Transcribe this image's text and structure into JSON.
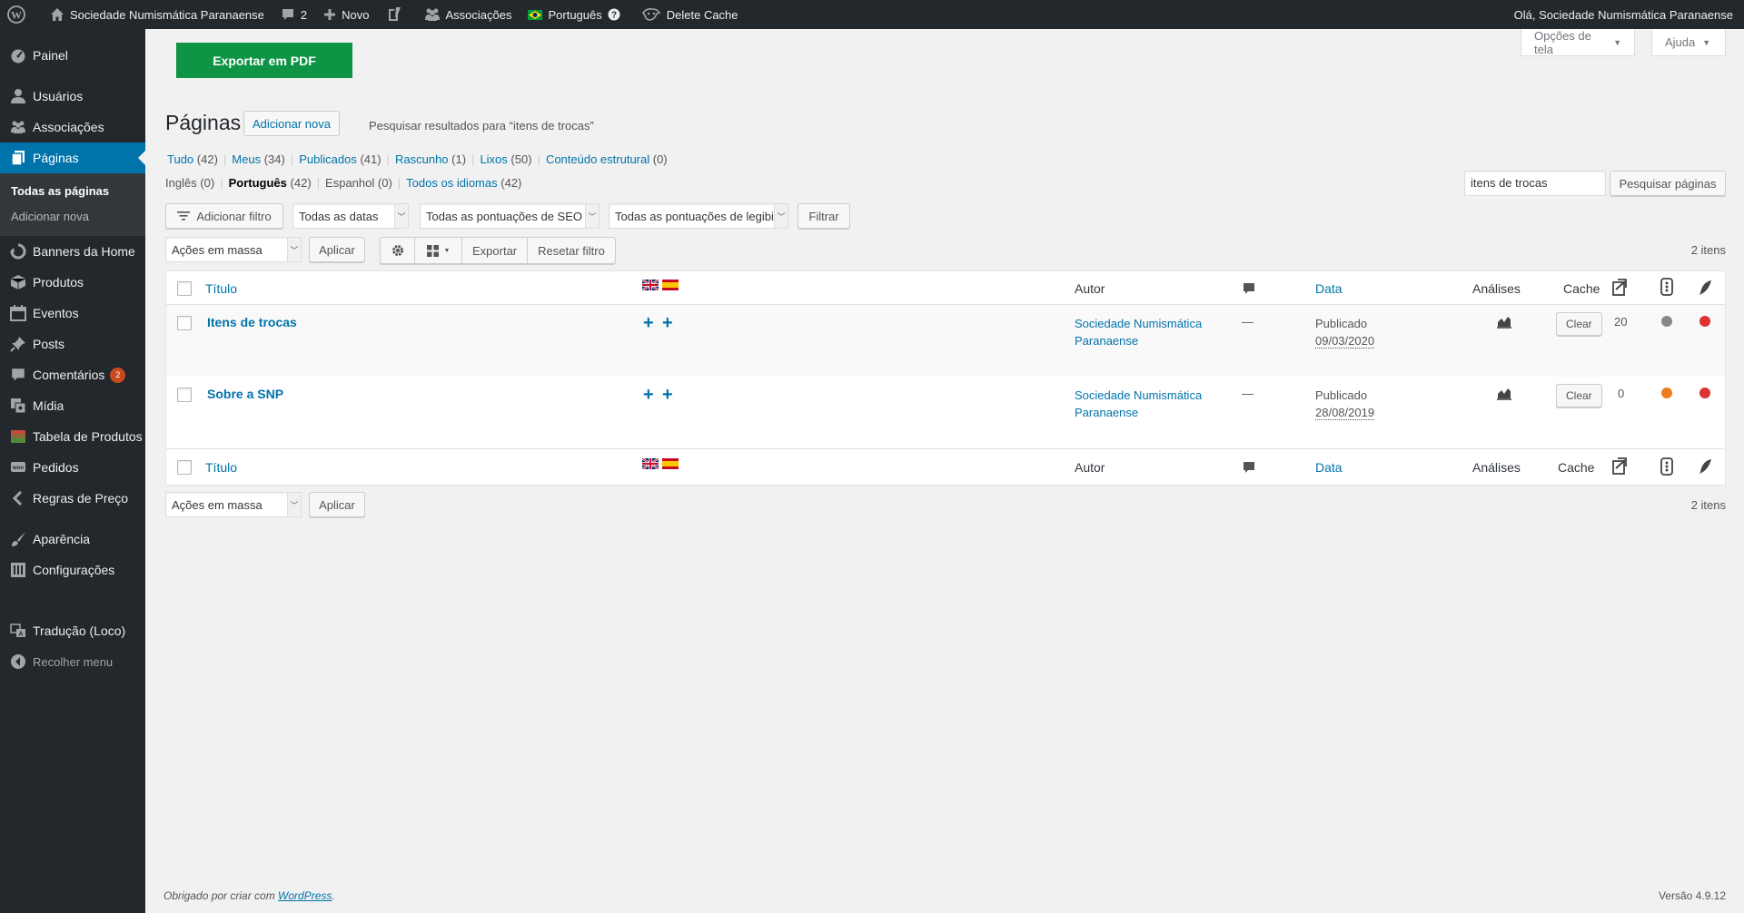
{
  "adminbar": {
    "site_name": "Sociedade Numismática Paranaense",
    "comments_count": "2",
    "new_label": "Novo",
    "associations_label": "Associações",
    "language_label": "Português",
    "delete_cache_label": "Delete Cache",
    "greeting": "Olá, Sociedade Numismática Paranaense"
  },
  "sidebar": {
    "items": [
      {
        "label": "Painel"
      },
      {
        "label": "Usuários"
      },
      {
        "label": "Associações"
      },
      {
        "label": "Páginas"
      },
      {
        "label": "Banners da Home"
      },
      {
        "label": "Produtos"
      },
      {
        "label": "Eventos"
      },
      {
        "label": "Posts"
      },
      {
        "label": "Comentários",
        "badge": "2"
      },
      {
        "label": "Mídia"
      },
      {
        "label": "Tabela de Produtos"
      },
      {
        "label": "Pedidos"
      },
      {
        "label": "Regras de Preço"
      },
      {
        "label": "Aparência"
      },
      {
        "label": "Configurações"
      },
      {
        "label": "Tradução (Loco)"
      },
      {
        "label": "Recolher menu"
      }
    ],
    "submenu": [
      "Todas as páginas",
      "Adicionar nova"
    ]
  },
  "screen_options": {
    "options_label": "Opções de tela",
    "help_label": "Ajuda"
  },
  "export_pdf_label": "Exportar em PDF",
  "heading": {
    "title": "Páginas",
    "add_new": "Adicionar nova",
    "search_results": "Pesquisar resultados para “itens de trocas”"
  },
  "status_filters": [
    {
      "label": "Tudo",
      "count": "(42)"
    },
    {
      "label": "Meus",
      "count": "(34)"
    },
    {
      "label": "Publicados",
      "count": "(41)"
    },
    {
      "label": "Rascunho",
      "count": "(1)"
    },
    {
      "label": "Lixos",
      "count": "(50)"
    },
    {
      "label": "Conteúdo estrutural",
      "count": "(0)"
    }
  ],
  "language_filters": [
    {
      "label": "Inglês",
      "count": "(0)"
    },
    {
      "label": "Português",
      "count": "(42)"
    },
    {
      "label": "Espanhol",
      "count": "(0)"
    },
    {
      "label": "Todos os idiomas",
      "count": "(42)"
    }
  ],
  "search": {
    "value": "itens de trocas",
    "button": "Pesquisar páginas"
  },
  "filters": {
    "add_filter": "Adicionar filtro",
    "dates": "Todas as datas",
    "seo": "Todas as pontuações de SEO",
    "readability": "Todas as pontuações de legibilidade",
    "filter_button": "Filtrar"
  },
  "bulk": {
    "label": "Ações em massa",
    "apply": "Aplicar",
    "export": "Exportar",
    "reset": "Resetar filtro"
  },
  "items_count": "2 itens",
  "table": {
    "columns": {
      "title": "Título",
      "author": "Autor",
      "date": "Data",
      "analytics": "Análises",
      "cache": "Cache"
    },
    "rows": [
      {
        "title": "Itens de trocas",
        "author_line1": "Sociedade Numismática",
        "author_line2": "Paranaense",
        "comments": "—",
        "status": "Publicado",
        "date": "09/03/2020",
        "clear": "Clear",
        "links": "20",
        "seo_color": "#888888",
        "readability_color": "#dc3232"
      },
      {
        "title": "Sobre a SNP",
        "author_line1": "Sociedade Numismática",
        "author_line2": "Paranaense",
        "comments": "—",
        "status": "Publicado",
        "date": "28/08/2019",
        "clear": "Clear",
        "links": "0",
        "seo_color": "#ee7c1b",
        "readability_color": "#dc3232"
      }
    ]
  },
  "footer": {
    "thanks": "Obrigado por criar com ",
    "wp_link": "WordPress",
    "dot": ".",
    "version": "Versão 4.9.12"
  },
  "colors": {
    "accent": "#0073aa",
    "export_button": "#0e9444",
    "adminbar": "#23282d"
  }
}
